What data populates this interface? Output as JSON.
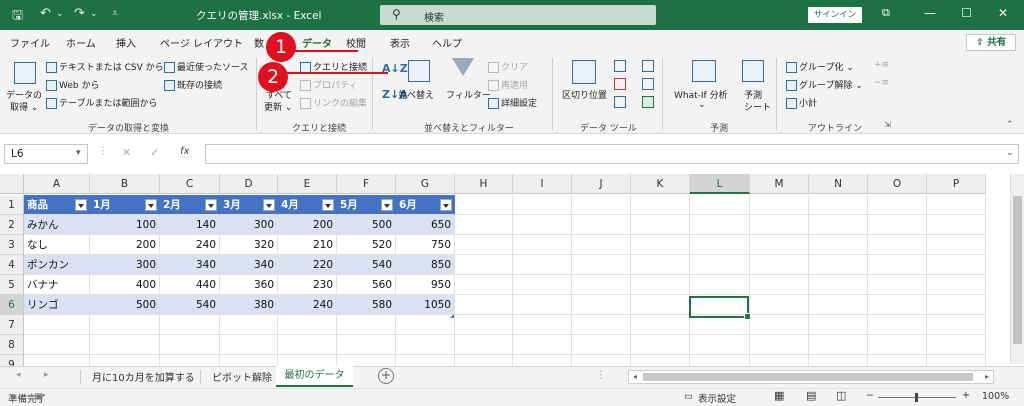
{
  "titlebar": {
    "filename": "クエリの管理.xlsx",
    "app_suffix": "-  Excel",
    "search_placeholder": "検索",
    "signin": "サインイン",
    "icons": [
      "save-icon",
      "undo-icon",
      "redo-icon",
      "customize-icon"
    ]
  },
  "tabs": [
    "ファイル",
    "ホーム",
    "挿入",
    "ページ レイアウト",
    "数",
    "データ",
    "校閲",
    "表示",
    "ヘルプ"
  ],
  "share": "共有",
  "ribbon": {
    "get_data": {
      "label": "データの",
      "label2": "取得",
      "text_csv": "テキストまたは CSV から",
      "web": "Web から",
      "table_range": "テーブルまたは範囲から",
      "recent": "最近使ったソース",
      "existing": "既存の接続",
      "group": "データの取得と変換"
    },
    "queries": {
      "refresh_all": "すべて",
      "refresh_all2": "更新",
      "queries_connections": "クエリと接続",
      "properties": "プロパティ",
      "edit_links": "リンクの編集",
      "group": "クエリと接続"
    },
    "sort_filter": {
      "sort": "並べ替え",
      "filter": "フィルター",
      "clear": "クリア",
      "reapply": "再適用",
      "advanced": "詳細設定",
      "group": "並べ替えとフィルター"
    },
    "data_tools": {
      "text_to_columns": "区切り位置",
      "group": "データ ツール"
    },
    "forecast": {
      "whatif": "What-If 分析",
      "forecast_sheet": "予測",
      "forecast_sheet2": "シート",
      "group": "予測"
    },
    "outline": {
      "group_btn": "グループ化",
      "ungroup": "グループ解除",
      "subtotal": "小計",
      "group": "アウトライン"
    }
  },
  "formula_bar": {
    "name_box": "L6",
    "cancel": "✕",
    "enter": "✓",
    "fx": "fx",
    "value": ""
  },
  "columns": [
    "A",
    "B",
    "C",
    "D",
    "E",
    "F",
    "G",
    "H",
    "I",
    "J",
    "K",
    "L",
    "M",
    "N",
    "O",
    "P"
  ],
  "selected_column": "L",
  "rows": [
    "1",
    "2",
    "3",
    "4",
    "5",
    "6",
    "7",
    "8",
    "9"
  ],
  "table": {
    "headers": [
      "商品",
      "1月",
      "2月",
      "3月",
      "4月",
      "5月",
      "6月"
    ],
    "data": [
      [
        "みかん",
        "100",
        "140",
        "300",
        "200",
        "500",
        "650"
      ],
      [
        "なし",
        "200",
        "240",
        "320",
        "210",
        "520",
        "750"
      ],
      [
        "ポンカン",
        "300",
        "340",
        "340",
        "220",
        "540",
        "850"
      ],
      [
        "バナナ",
        "400",
        "440",
        "360",
        "230",
        "560",
        "950"
      ],
      [
        "リンゴ",
        "500",
        "540",
        "380",
        "240",
        "580",
        "1050"
      ]
    ],
    "header_color": "#4472c4",
    "band_color": "#d9e1f2"
  },
  "sheets": [
    "月に10カ月を加算する",
    "ピボット解除",
    "最初のデータ"
  ],
  "active_sheet": "最初のデータ",
  "status": {
    "ready": "準備完了",
    "display_settings": "表示設定",
    "zoom": "100%"
  },
  "annotations": [
    "1",
    "2"
  ],
  "accent": "#1e7145"
}
